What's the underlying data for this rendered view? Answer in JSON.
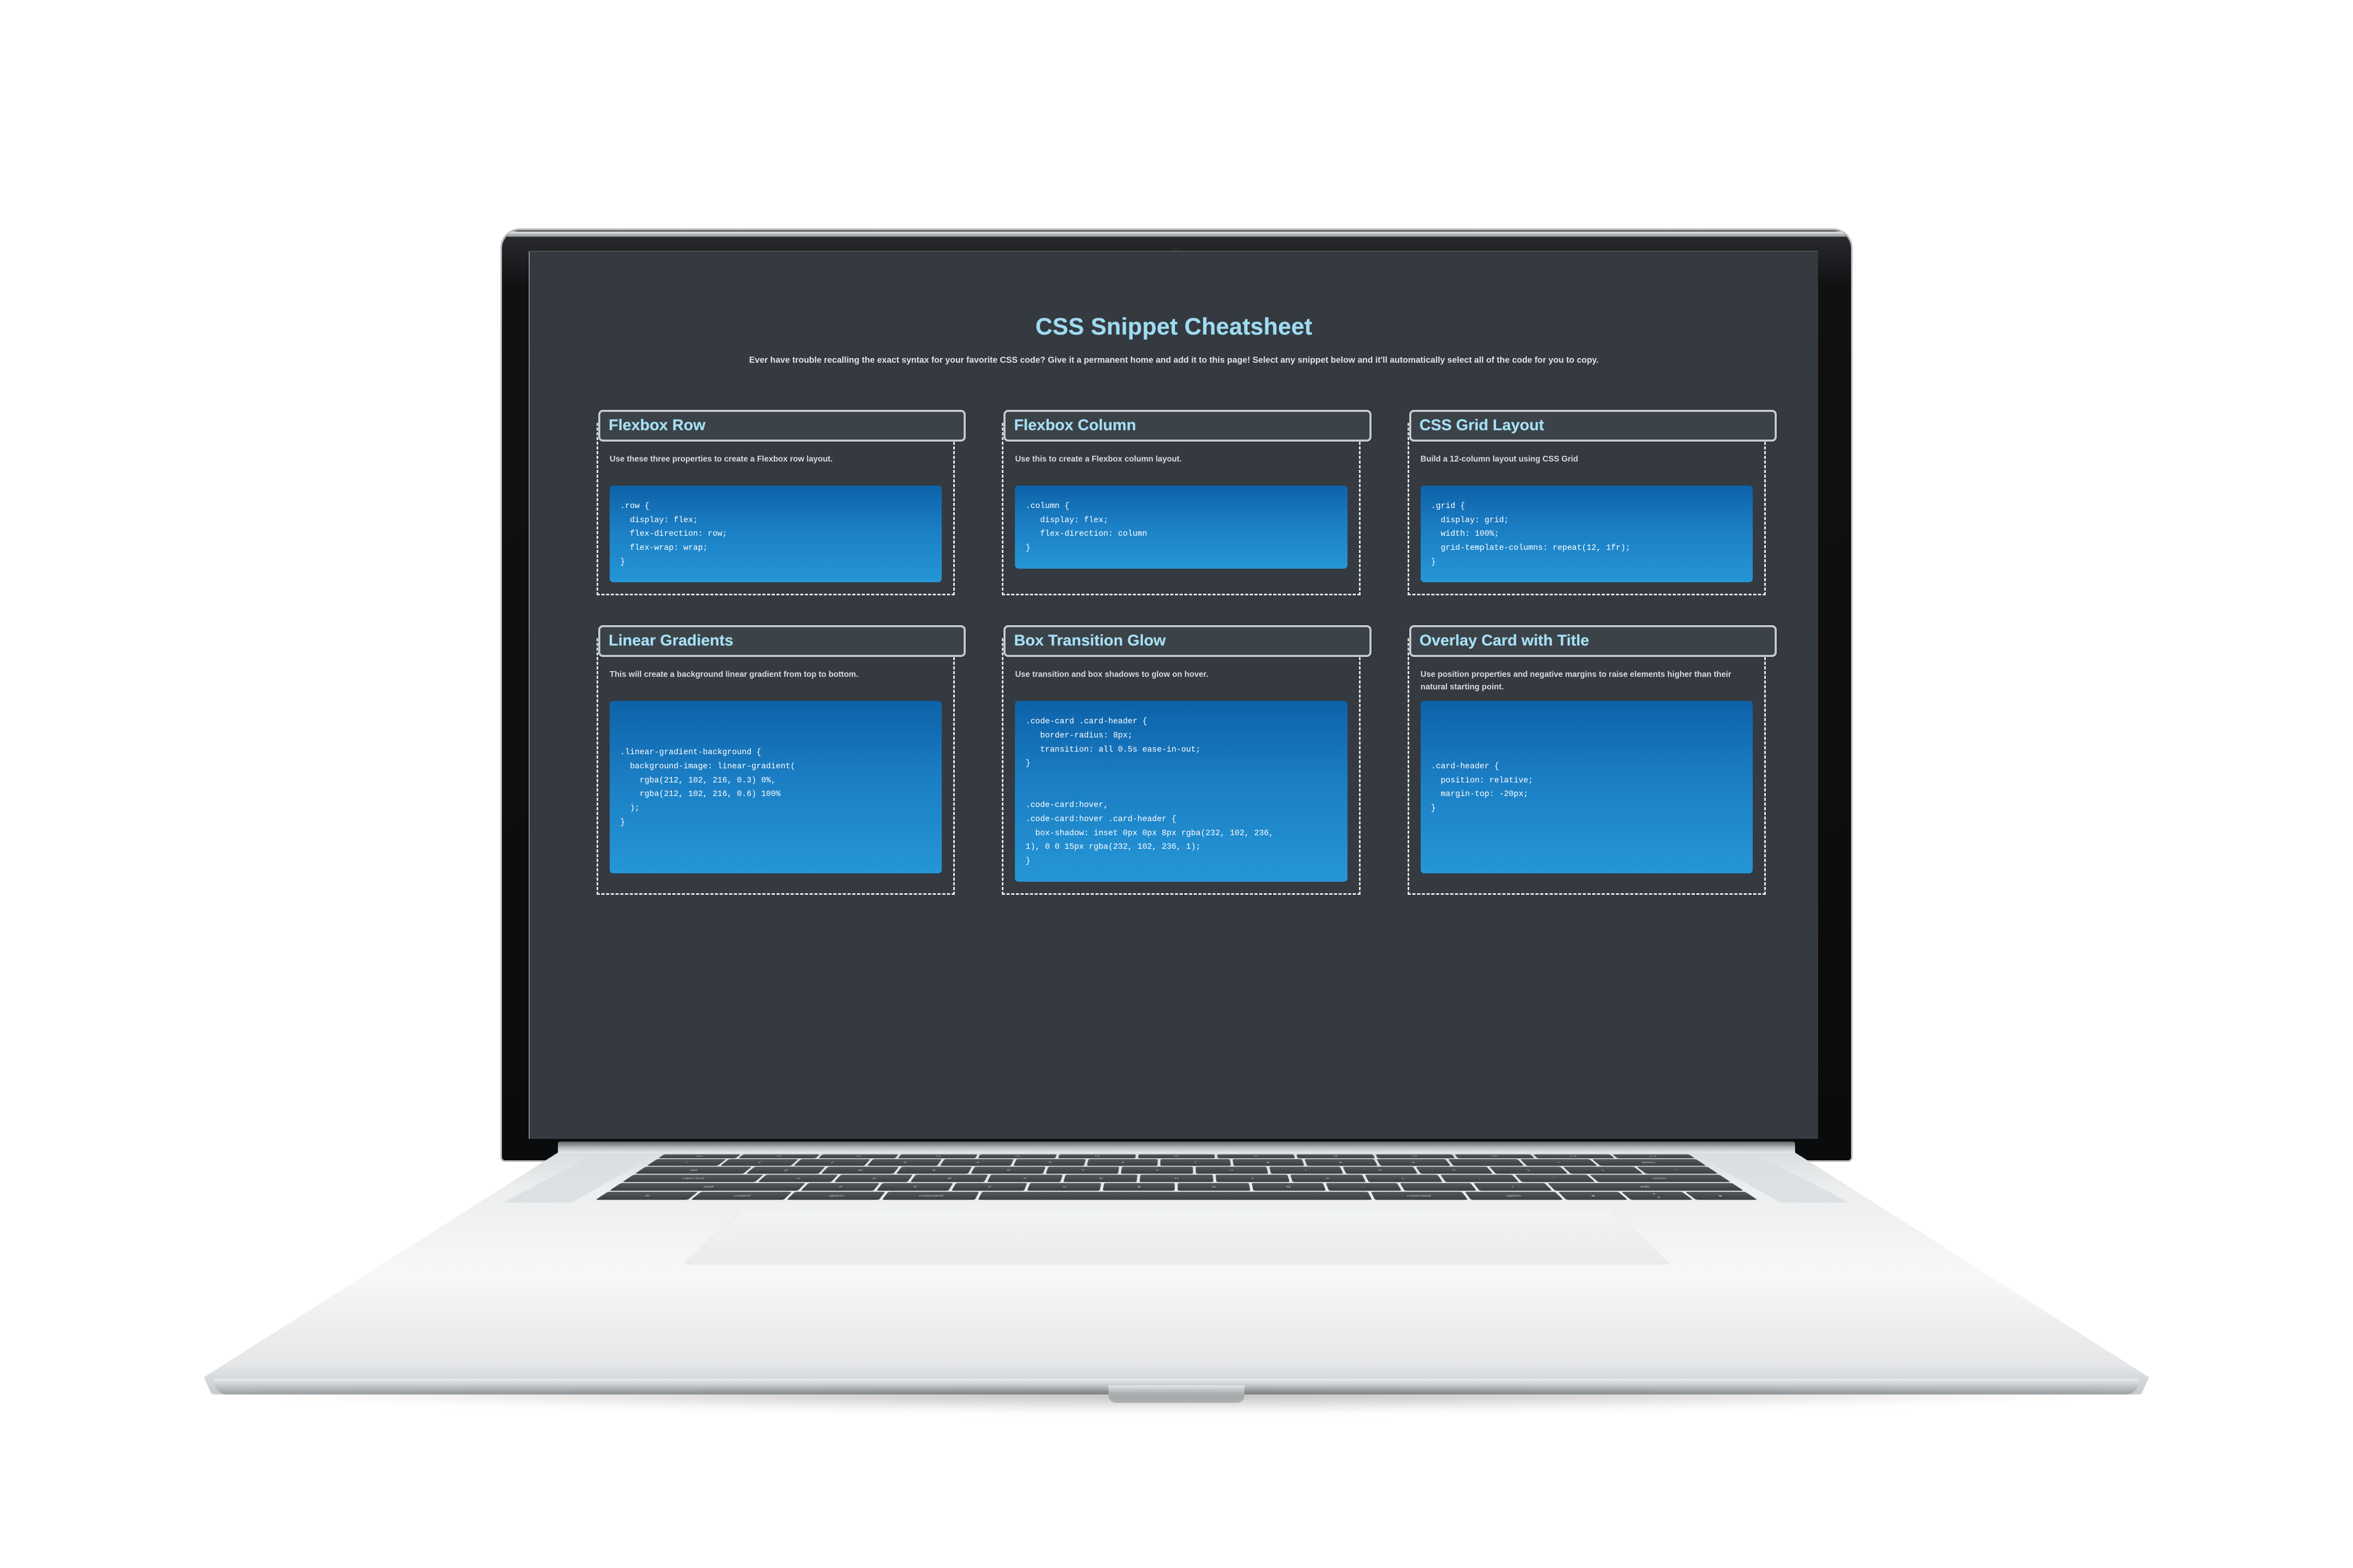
{
  "device": {
    "type": "laptop",
    "webcam": "webcam-icon"
  },
  "page": {
    "title": "CSS Snippet Cheatsheet",
    "subtitle": "Ever have trouble recalling the exact syntax for your favorite CSS code? Give it a permanent home and add it to this page! Select any snippet below and it'll automatically select all of the code for you to copy.",
    "background_color": "#343a40",
    "accent_color": "#9fdcf2",
    "code_gradient_from": "#0d62a8",
    "code_gradient_to": "#2596d6"
  },
  "cards": [
    {
      "title": "Flexbox Row",
      "description": "Use these three properties to create a Flexbox row layout.",
      "code": ".row {\n  display: flex;\n  flex-direction: row;\n  flex-wrap: wrap;\n}"
    },
    {
      "title": "Flexbox Column",
      "description": "Use this to create a Flexbox column layout.",
      "code": ".column {\n   display: flex;\n   flex-direction: column\n}"
    },
    {
      "title": "CSS Grid Layout",
      "description": "Build a 12-column layout using CSS Grid",
      "code": ".grid {\n  display: grid;\n  width: 100%;\n  grid-template-columns: repeat(12, 1fr);\n}"
    },
    {
      "title": "Linear Gradients",
      "description": "This will create a background linear gradient from top to bottom.",
      "code": ".linear-gradient-background {\n  background-image: linear-gradient(\n    rgba(212, 102, 216, 0.3) 0%,\n    rgba(212, 102, 216, 0.6) 100%\n  );\n}"
    },
    {
      "title": "Box Transition Glow",
      "description": "Use transition and box shadows to glow on hover.",
      "code": ".code-card .card-header {\n   border-radius: 8px;\n   transition: all 0.5s ease-in-out;\n}\n\n\n.code-card:hover,\n.code-card:hover .card-header {\n  box-shadow: inset 0px 0px 8px rgba(232, 102, 236,\n1), 0 0 15px rgba(232, 102, 236, 1);\n}"
    },
    {
      "title": "Overlay Card with Title",
      "description": "Use position properties and negative margins to raise elements higher than their natural starting point.",
      "code": ".card-header {\n  position: relative;\n  margin-top: -20px;\n}"
    }
  ],
  "keyboard": {
    "fn_row": [
      "esc",
      "F1",
      "F2",
      "F3",
      "F4",
      "F5",
      "F6",
      "F7",
      "F8",
      "F9",
      "F10",
      "F11",
      "F12"
    ],
    "row1": [
      "~",
      "1",
      "2",
      "3",
      "4",
      "5",
      "6",
      "7",
      "8",
      "9",
      "0",
      "-",
      "+",
      "delete"
    ],
    "row2": [
      "tab",
      "Q",
      "W",
      "E",
      "R",
      "T",
      "Y",
      "U",
      "I",
      "O",
      "P",
      "[",
      "]",
      "\\"
    ],
    "row3": [
      "caps lock",
      "A",
      "S",
      "D",
      "F",
      "G",
      "H",
      "J",
      "K",
      "L",
      ";",
      "\"",
      "return"
    ],
    "row4": [
      "shift",
      "Z",
      "X",
      "C",
      "V",
      "B",
      "N",
      "M",
      ",",
      ".",
      "/",
      "shift"
    ],
    "row5": [
      "fn",
      "control",
      "option",
      "command",
      "",
      "command",
      "option",
      "◄",
      "▲▼",
      "►"
    ]
  }
}
